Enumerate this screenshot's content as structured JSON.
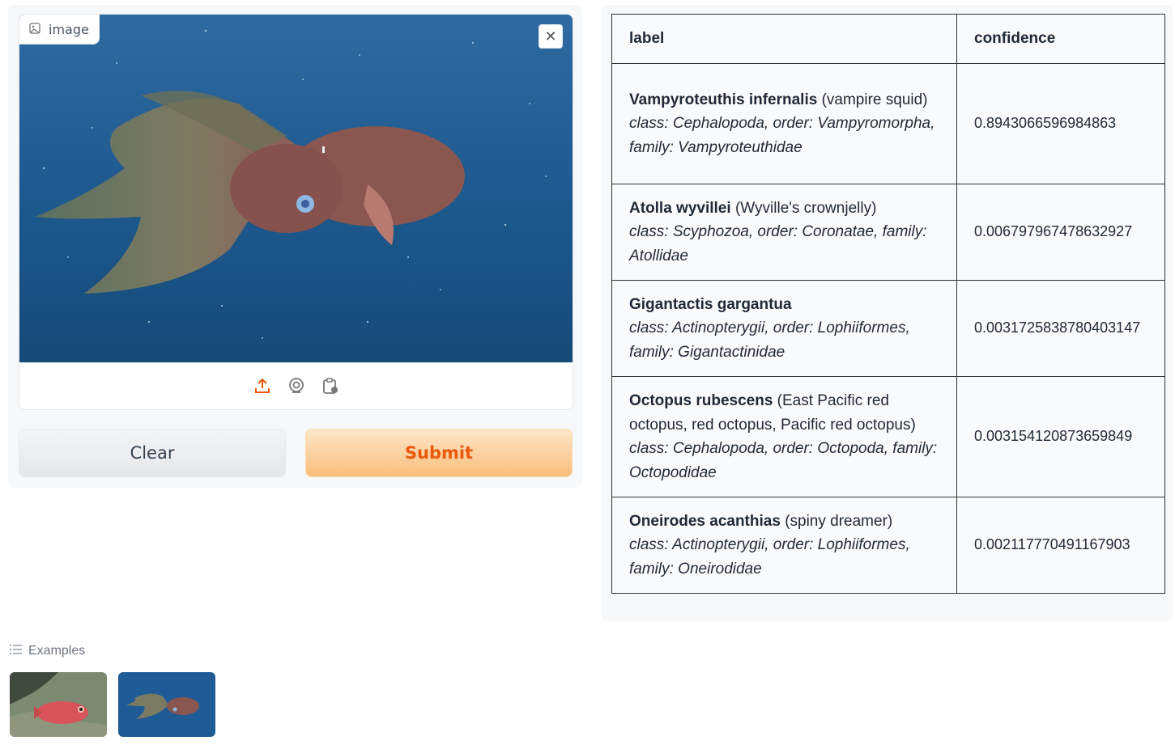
{
  "input": {
    "label": "image",
    "close_icon": "close-icon",
    "sources": [
      "upload-icon",
      "webcam-icon",
      "clipboard-icon"
    ]
  },
  "buttons": {
    "clear": "Clear",
    "submit": "Submit"
  },
  "results": {
    "headers": [
      "label",
      "confidence"
    ],
    "rows": [
      {
        "name": "Vampyroteuthis infernalis",
        "common": "(vampire squid)",
        "taxonomy": "class: Cephalopoda, order: Vampyromorpha, family: Vampyroteuthidae",
        "confidence": "0.8943066596984863"
      },
      {
        "name": "Atolla wyvillei",
        "common": "(Wyville's crownjelly)",
        "taxonomy": "class: Scyphozoa, order: Coronatae, family: Atollidae",
        "confidence": "0.006797967478632927"
      },
      {
        "name": "Gigantactis gargantua",
        "common": "",
        "taxonomy": "class: Actinopterygii, order: Lophiiformes, family: Gigantactinidae",
        "confidence": "0.003172583878040314​7"
      },
      {
        "name": "Octopus rubescens",
        "common": "(East Pacific red octopus, red octopus, Pacific red octopus)",
        "taxonomy": "class: Cephalopoda, order: Octopoda, family: Octopodidae",
        "confidence": "0.003154120873659849"
      },
      {
        "name": "Oneirodes acanthias",
        "common": "(spiny dreamer)",
        "taxonomy": "class: Actinopterygii, order: Lophiiformes, family: Oneirodidae",
        "confidence": "0.002117770491167903"
      }
    ]
  },
  "examples": {
    "title": "Examples"
  },
  "colors": {
    "accent": "#ea580c",
    "submit_bg": "#f9bd7b"
  }
}
